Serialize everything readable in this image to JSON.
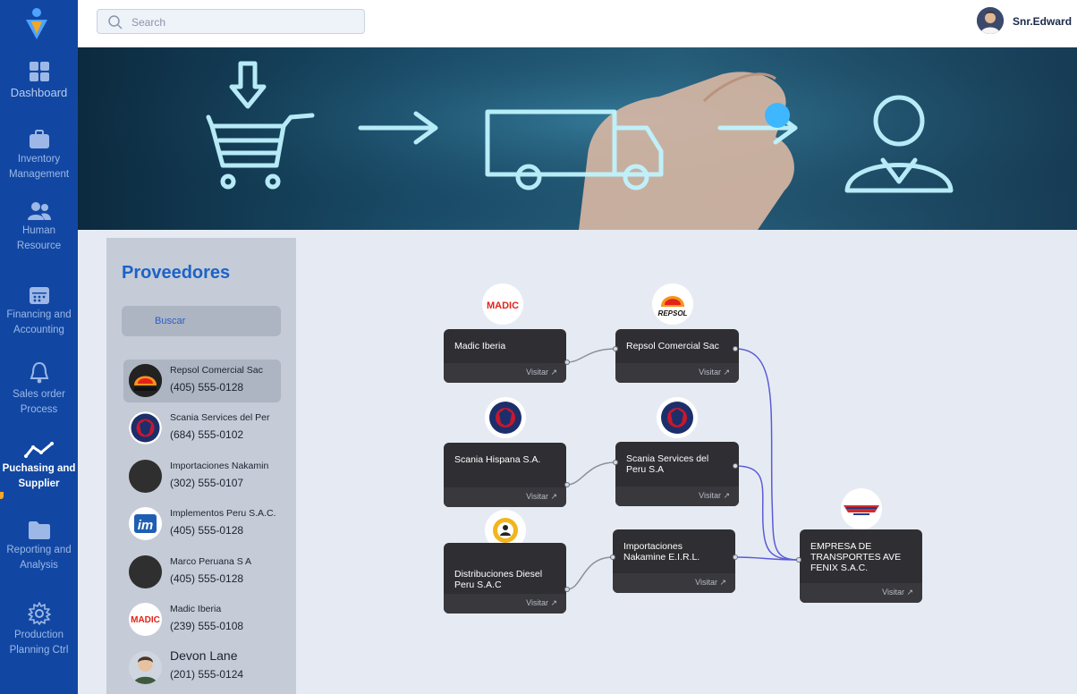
{
  "sidebar": {
    "items": [
      {
        "label": "Dashboard",
        "icon": "grid-icon"
      },
      {
        "label": "Inventory Management",
        "icon": "briefcase-icon"
      },
      {
        "label": "Human Resource",
        "icon": "users-icon"
      },
      {
        "label": "Financing and Accounting",
        "icon": "calendar-icon"
      },
      {
        "label": "Sales order Process",
        "icon": "bell-icon"
      },
      {
        "label": "Puchasing and Supplier",
        "icon": "trend-icon"
      },
      {
        "label": "Reporting and Analysis",
        "icon": "folder-icon"
      },
      {
        "label": "Production Planning Ctrl",
        "icon": "gear-icon"
      }
    ],
    "active_index": 5
  },
  "header": {
    "search_placeholder": "Search",
    "user_name": "Snr.Edward"
  },
  "panel": {
    "title": "Proveedores",
    "search_label": "Buscar",
    "suppliers": [
      {
        "name": "Repsol Comercial Sac",
        "phone": "(405) 555-0128",
        "selected": true
      },
      {
        "name": "Scania Services del Per",
        "phone": "(684) 555-0102"
      },
      {
        "name": "Importaciones Nakamin",
        "phone": "(302) 555-0107"
      },
      {
        "name": "Implementos Peru S.A.C.",
        "phone": "(405) 555-0128"
      },
      {
        "name": "Marco Peruana S A",
        "phone": "(405) 555-0128"
      },
      {
        "name": "Madic Iberia",
        "phone": "(239) 555-0108"
      },
      {
        "name": "Devon Lane",
        "phone": "(201) 555-0124"
      }
    ]
  },
  "flow": {
    "visit_label": "Visitar",
    "nodes": {
      "madic_iberia": "Madic Iberia",
      "repsol": "Repsol Comercial Sac",
      "scania_hispana": "Scania Hispana S.A.",
      "scania_peru": "Scania Services del Peru S.A",
      "distribuciones": "Distribuciones Diesel Peru S.A.C",
      "nakamine": "Importaciones Nakamine E.I.R.L.",
      "fenix": "EMPRESA DE TRANSPORTES AVE FENIX S.A.C."
    },
    "logos": {
      "madic": "MADIC",
      "repsol": "REPSOL",
      "implementos": "im"
    }
  },
  "colors": {
    "sidebar": "#1147a3",
    "accent": "#f2a72a",
    "title": "#1b63c7",
    "node": "#2f2f33",
    "edge": "#5b5bd6"
  }
}
